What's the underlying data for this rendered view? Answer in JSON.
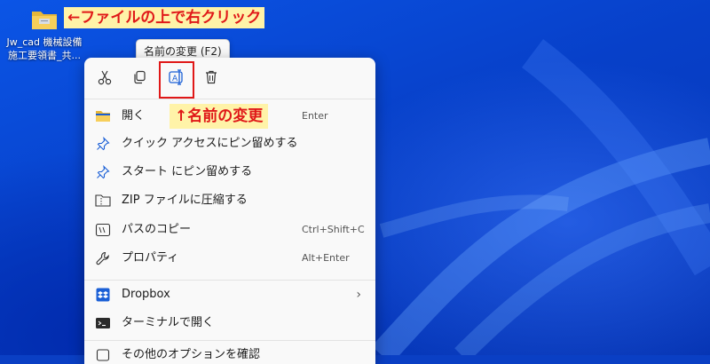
{
  "desktop": {
    "file": {
      "icon": "folder-icon",
      "label_line1": "Jw_cad 機械設備",
      "label_line2": "施工要領書_共..."
    }
  },
  "annotations": {
    "right_click": "←ファイルの上で右クリック",
    "rename": "↑名前の変更"
  },
  "tooltip": {
    "text": "名前の変更 (F2)"
  },
  "menu": {
    "toolbar": [
      {
        "name": "cut",
        "icon": "scissors-icon"
      },
      {
        "name": "copy",
        "icon": "copy-icon"
      },
      {
        "name": "rename",
        "icon": "rename-icon"
      },
      {
        "name": "delete",
        "icon": "trash-icon"
      }
    ],
    "items": [
      {
        "label": "開く",
        "shortcut": "Enter",
        "icon": "folder-open-icon"
      },
      {
        "label": "クイック アクセスにピン留めする",
        "shortcut": "",
        "icon": "pin-icon"
      },
      {
        "label": "スタート にピン留めする",
        "shortcut": "",
        "icon": "pin-icon"
      },
      {
        "label": "ZIP ファイルに圧縮する",
        "shortcut": "",
        "icon": "zip-icon"
      },
      {
        "label": "パスのコピー",
        "shortcut": "Ctrl+Shift+C",
        "icon": "path-copy-icon"
      },
      {
        "label": "プロパティ",
        "shortcut": "Alt+Enter",
        "icon": "wrench-icon"
      },
      {
        "label": "Dropbox",
        "shortcut": "",
        "icon": "dropbox-icon",
        "submenu": "›"
      },
      {
        "label": "ターミナルで開く",
        "shortcut": "",
        "icon": "terminal-icon"
      },
      {
        "label": "その他のオプションを確認",
        "shortcut": "",
        "icon": "more-options-icon"
      }
    ]
  },
  "colors": {
    "annotation_bg": "#fff3a8",
    "annotation_text": "#e01818",
    "highlight_border": "#e01818",
    "desktop_blue": "#0a3fc4"
  }
}
